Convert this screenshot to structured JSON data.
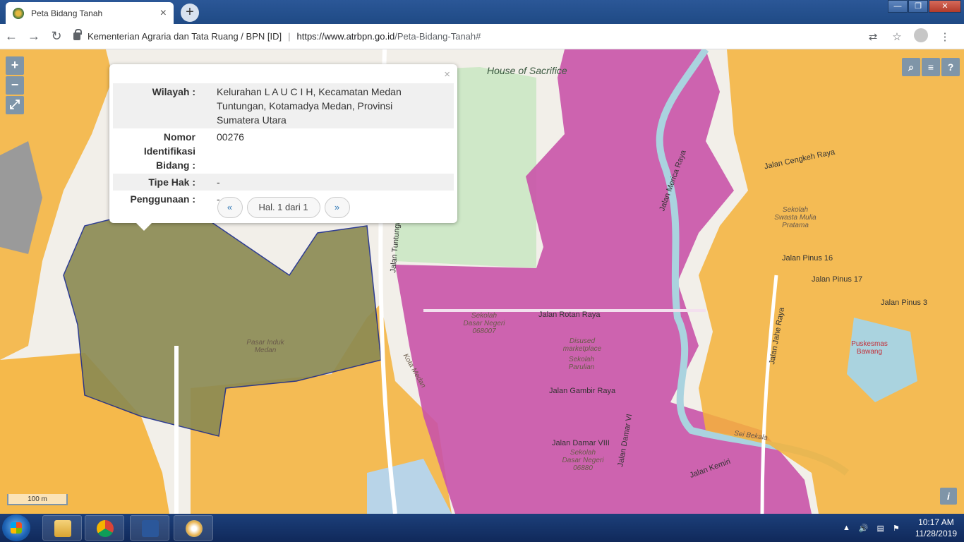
{
  "browser": {
    "tab_title": "Peta Bidang Tanah",
    "tab_close": "×",
    "new_tab": "+",
    "site_name": "Kementerian Agraria dan Tata Ruang / BPN [ID]",
    "url_domain": "https://www.atrbpn.go.id",
    "url_path": "/Peta-Bidang-Tanah#",
    "back": "←",
    "forward": "→",
    "reload": "↻",
    "translate": "⇄",
    "star": "☆",
    "menu": "⋮",
    "win_min": "—",
    "win_max": "❐",
    "win_close": "✕"
  },
  "map": {
    "zoom_in": "+",
    "zoom_out": "−",
    "fullscreen": "⤢",
    "search": "⌕",
    "layers": "≡",
    "help": "?",
    "info": "i",
    "scale": "100 m",
    "labels": {
      "house_of_sacrifice": "House of Sacrifice",
      "jalan_cengkeh_raya": "Jalan Cengkeh Raya",
      "jalan_merica_raya": "Jalan Merica Raya",
      "jalan_rotan_raya": "Jalan Rotan Raya",
      "jalan_gambir_raya": "Jalan Gambir Raya",
      "jalan_damar_viii": "Jalan Damar VIII",
      "jalan_damar_vi": "Jalan Damar VI",
      "jalan_pinus_16": "Jalan Pinus 16",
      "jalan_pinus_17": "Jalan Pinus 17",
      "jalan_pinus_3": "Jalan Pinus 3",
      "jalan_jahe_raya": "Jalan Jahe Raya",
      "jalan_kemiri": "Jalan Kemiri",
      "jalan_tuntungan": "Jalan Tuntungan",
      "kota_medan": "Kota Medan",
      "sei_bekala": "Sei Bekala",
      "pasar_induk_medan": "Pasar Induk Medan",
      "sekolah_dasar_negeri": "Sekolah Dasar Negeri 068007",
      "disused_marketplace": "Disused marketplace",
      "sekolah_parulian": "Sekolah Parulian",
      "sekolah_swasta": "Sekolah Swasta Mulia Pratama",
      "puskesmas_bawang": "Puskesmas Bawang",
      "sekolah_06880": "Sekolah Dasar Negeri 06880"
    }
  },
  "popup": {
    "close": "×",
    "rows": [
      {
        "key": "Wilayah :",
        "value": "Kelurahan L A U C I H, Kecamatan Medan Tuntungan, Kotamadya Medan, Provinsi Sumatera Utara"
      },
      {
        "key": "Nomor Identifikasi Bidang :",
        "value": "00276"
      },
      {
        "key": "Tipe Hak :",
        "value": "-"
      },
      {
        "key": "Penggunaan :",
        "value": "-"
      }
    ],
    "prev": "«",
    "page_label": "Hal. 1 dari 1",
    "next": "»"
  },
  "taskbar": {
    "time": "10:17 AM",
    "date": "11/28/2019"
  },
  "colors": {
    "parcel_orange": "#f5b23a",
    "parcel_magenta": "#c953a8",
    "selected_parcel": "#8a8a52",
    "river": "#aad3df",
    "park": "#c8e6c0"
  }
}
